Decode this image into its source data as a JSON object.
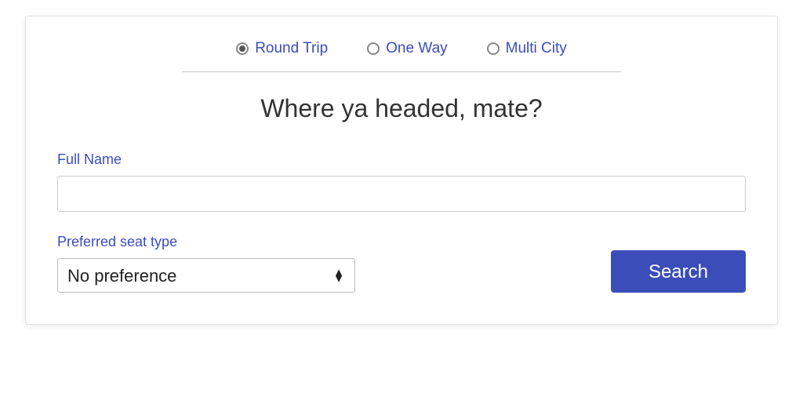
{
  "tripTypes": {
    "roundTrip": "Round Trip",
    "oneWay": "One Way",
    "multiCity": "Multi City"
  },
  "heading": "Where ya headed, mate?",
  "fullName": {
    "label": "Full Name",
    "value": ""
  },
  "seatType": {
    "label": "Preferred seat type",
    "selected": "No preference"
  },
  "searchLabel": "Search"
}
